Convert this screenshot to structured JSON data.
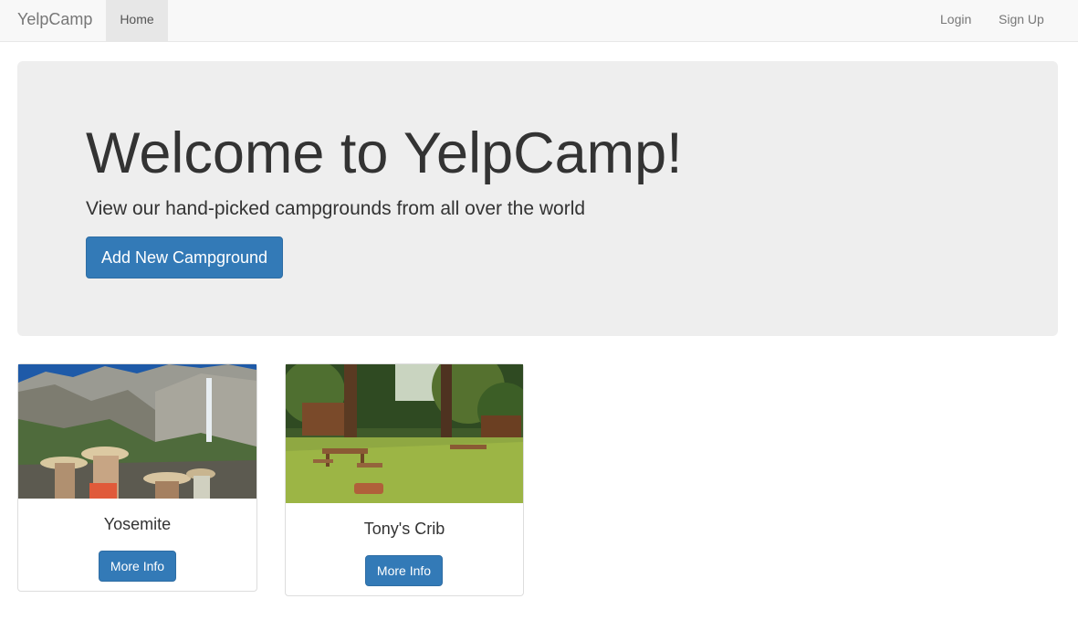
{
  "navbar": {
    "brand": "YelpCamp",
    "home_label": "Home",
    "login_label": "Login",
    "signup_label": "Sign Up"
  },
  "jumbotron": {
    "title": "Welcome to YelpCamp!",
    "subtitle": "View our hand-picked campgrounds from all over the world",
    "add_button_label": "Add New Campground"
  },
  "campgrounds": [
    {
      "name": "Yosemite",
      "button_label": "More Info",
      "image": "photo-yosemite-waterfall-rangers"
    },
    {
      "name": "Tony's Crib",
      "button_label": "More Info",
      "image": "photo-forest-campsite-picnic-tables"
    }
  ],
  "colors": {
    "primary": "#337ab7",
    "navbar_bg": "#f8f8f8",
    "jumbotron_bg": "#eeeeee",
    "text": "#333333"
  }
}
